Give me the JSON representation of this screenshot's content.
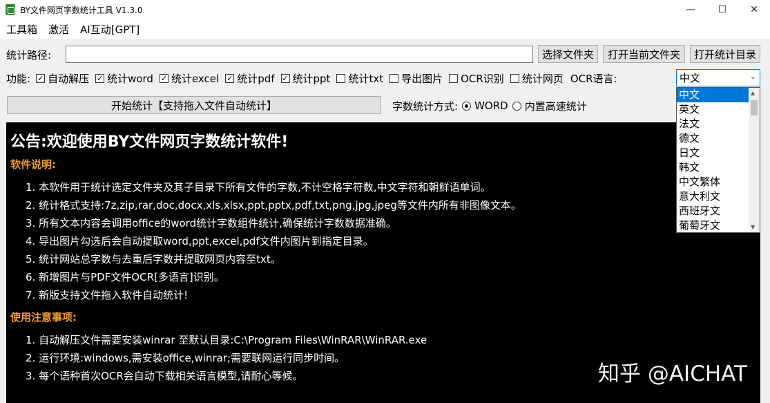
{
  "window": {
    "title": "BY文件网页字数统计工具 V1.3.0",
    "minimize": "—",
    "maximize": "☐",
    "close": "✕"
  },
  "menu": [
    "工具箱",
    "激活",
    "AI互动[GPT]"
  ],
  "path": {
    "label": "统计路径:",
    "value": "",
    "buttons": [
      "选择文件夹",
      "打开当前文件夹",
      "打开统计目录"
    ]
  },
  "functions": {
    "label": "功能:",
    "options": [
      {
        "label": "自动解压",
        "checked": true
      },
      {
        "label": "统计word",
        "checked": true
      },
      {
        "label": "统计excel",
        "checked": true
      },
      {
        "label": "统计pdf",
        "checked": true
      },
      {
        "label": "统计ppt",
        "checked": true
      },
      {
        "label": "统计txt",
        "checked": false
      },
      {
        "label": "导出图片",
        "checked": false
      },
      {
        "label": "OCR识别",
        "checked": false
      },
      {
        "label": "统计网页",
        "checked": false
      }
    ],
    "ocr_label": "OCR语言:",
    "ocr_selected": "中文",
    "ocr_options": [
      "中文",
      "英文",
      "法文",
      "德文",
      "日文",
      "韩文",
      "中文繁体",
      "意大利文",
      "西班牙文",
      "葡萄牙文"
    ]
  },
  "start_button": "开始统计【支持拖入文件自动统计】",
  "count_mode": {
    "label": "字数统计方式:",
    "options": [
      {
        "label": "WORD",
        "selected": true
      },
      {
        "label": "内置高速统计",
        "selected": false
      }
    ]
  },
  "console": {
    "title": "公告:欢迎使用BY文件网页字数统计软件!",
    "section1": "软件说明:",
    "items1": [
      "1. 本软件用于统计选定文件夹及其子目录下所有文件的字数,不计空格字符数,中文字符和朝鲜语单词。",
      "2. 统计格式支持:7z,zip,rar,doc,docx,xls,xlsx,ppt,pptx,pdf,txt,png,jpg,jpeg等文件内所有非图像文本。",
      "3. 所有文本内容会调用office的word统计字数组件统计,确保统计字数数据准确。",
      "4. 导出图片勾选后会自动提取word,ppt,excel,pdf文件内图片到指定目录。",
      "5. 统计网站总字数与去重后字数并提取网页内容至txt。",
      "6. 新增图片与PDF文件OCR[多语言]识别。",
      "7. 新版支持文件拖入软件自动统计!"
    ],
    "section2": "使用注意事项:",
    "items2": [
      "1. 自动解压文件需要安装winrar 至默认目录:C:\\Program Files\\WinRAR\\WinRAR.exe",
      "2. 运行环境:windows,需安装office,winrar;需要联网运行同步时间。",
      "3. 每个语种首次OCR会自动下载相关语言模型,请耐心等候。"
    ]
  },
  "watermark": "知乎 @AICHAT"
}
